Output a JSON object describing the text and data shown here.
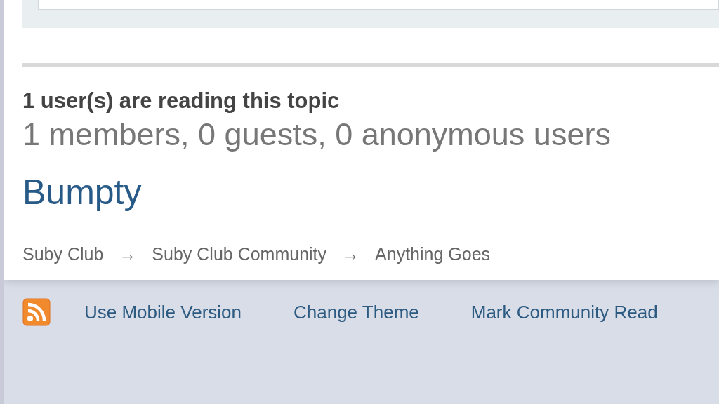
{
  "active_users": {
    "heading": "1 user(s) are reading this topic",
    "summary": "1 members, 0 guests, 0 anonymous users",
    "members": [
      "Bumpty"
    ]
  },
  "breadcrumb": [
    "Suby Club",
    "Suby Club Community",
    "Anything Goes"
  ],
  "breadcrumb_separator": "→",
  "footer_links": [
    "Use Mobile Version",
    "Change Theme",
    "Mark Community Read"
  ]
}
